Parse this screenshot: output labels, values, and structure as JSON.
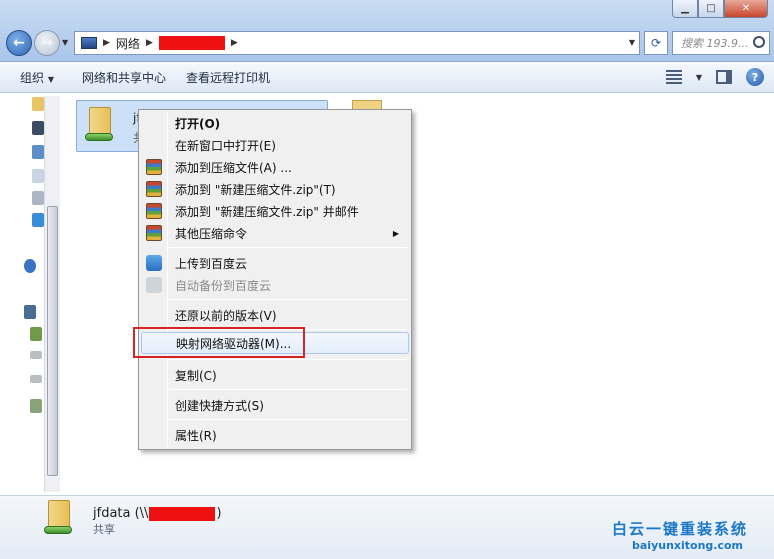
{
  "window": {
    "controls": {
      "minimize_icon": "minimize-icon",
      "maximize_icon": "maximize-icon",
      "close_icon": "close-icon"
    }
  },
  "address": {
    "breadcrumb": [
      "网络"
    ],
    "redacted": true
  },
  "search": {
    "placeholder": "搜索 193.9..."
  },
  "toolbar": {
    "organize": "组织",
    "network_center": "网络和共享中心",
    "remote_printers": "查看远程打印机"
  },
  "content": {
    "selected_item": {
      "name_partial": "jf",
      "sub_partial": "共"
    }
  },
  "context_menu": {
    "items": [
      {
        "label": "打开(O)",
        "bold": true
      },
      {
        "label": "在新窗口中打开(E)"
      },
      {
        "label": "添加到压缩文件(A) ...",
        "icon": "winrar-icon"
      },
      {
        "label": "添加到 \"新建压缩文件.zip\"(T)",
        "icon": "winrar-icon"
      },
      {
        "label": "添加到 \"新建压缩文件.zip\" 并邮件",
        "icon": "winrar-icon"
      },
      {
        "label": "其他压缩命令",
        "icon": "winrar-icon",
        "submenu": true
      },
      {
        "label": "上传到百度云",
        "icon": "baidu-cloud-icon"
      },
      {
        "label": "自动备份到百度云",
        "icon": "baidu-cloud-icon",
        "disabled": true
      },
      {
        "label": "还原以前的版本(V)"
      },
      {
        "label": "映射网络驱动器(M)...",
        "highlighted": true
      },
      {
        "label": "复制(C)"
      },
      {
        "label": "创建快捷方式(S)"
      },
      {
        "label": "属性(R)"
      }
    ]
  },
  "details": {
    "name_prefix": "jfdata (\\\\",
    "name_suffix": ")",
    "type": "共享"
  },
  "watermark": {
    "title": "白云一键重装系统",
    "url": "baiyunxitong.com"
  },
  "colors": {
    "highlight_box": "#d62424",
    "redaction": "#ee1111",
    "accent": "#1b78c8"
  }
}
